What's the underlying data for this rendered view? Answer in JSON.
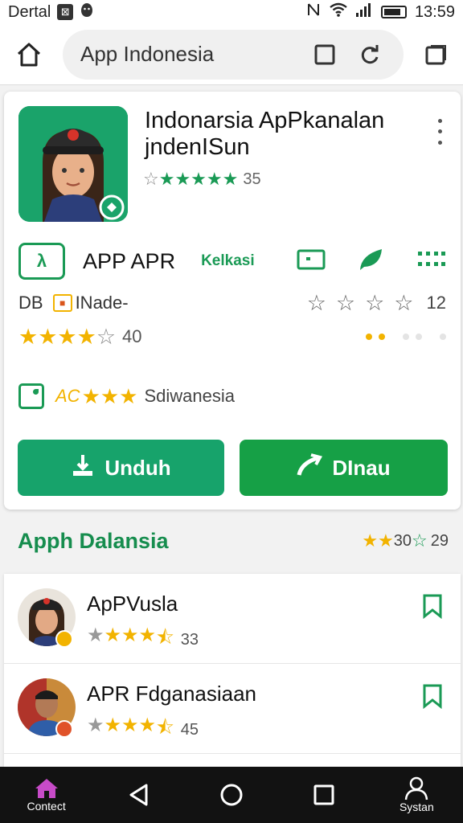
{
  "status_bar": {
    "app_label": "Dertal",
    "time": "13:59"
  },
  "address_bar": {
    "url": "App Indonesia"
  },
  "app_card": {
    "title": "Indonarsia ApPkanalan jndenISun",
    "rating_count": "35",
    "row1": {
      "label": "APP APR",
      "link": "Kelkasi"
    },
    "row2": {
      "label": "DB",
      "mid": "INade-",
      "count": "12"
    },
    "row3": {
      "count": "40"
    },
    "row4": {
      "prefix": "AC",
      "label": "Sdiwanesia"
    },
    "buttons": {
      "download": "Unduh",
      "secondary": "DInau"
    }
  },
  "section": {
    "title": "Apph Dalansia",
    "rating_a": "30",
    "rating_b": "29"
  },
  "list": [
    {
      "name": "ApPVusla",
      "rating": "33"
    },
    {
      "name": "APR Fdganasiaan",
      "rating": "45"
    }
  ],
  "bottom_nav": {
    "left_label": "Contect",
    "right_label": "Systan"
  },
  "colors": {
    "primary": "#17a36b",
    "green_dark": "#16a046",
    "star": "#f2b300",
    "nav_bg": "#121212"
  }
}
